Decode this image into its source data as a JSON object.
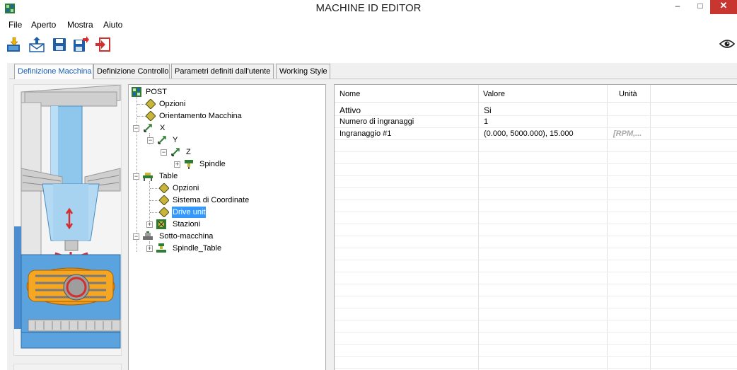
{
  "window": {
    "title": "MACHINE ID EDITOR",
    "minimize": "–",
    "maximize": "□",
    "close": "✕"
  },
  "menu": {
    "items": [
      "File",
      "Aperto",
      "Mostra",
      "Aiuto"
    ]
  },
  "toolbar": {
    "icons": [
      "import-icon",
      "export-icon",
      "save-icon",
      "save-as-icon",
      "exit-icon"
    ],
    "right_icon": "eye-icon"
  },
  "tabs": [
    {
      "label": "Definizione Macchina",
      "active": true
    },
    {
      "label": "Definizione Controllo",
      "active": false
    },
    {
      "label": "Parametri definiti dall'utente",
      "active": false
    },
    {
      "label": "Working Style",
      "active": false
    }
  ],
  "tree": {
    "nodes": [
      {
        "label": "POST",
        "icon": "machine-icon"
      },
      {
        "label": "Opzioni",
        "icon": "diamond-icon"
      },
      {
        "label": "Orientamento Macchina",
        "icon": "diamond-icon"
      },
      {
        "label": "X",
        "icon": "axis-icon",
        "expander": "−"
      },
      {
        "label": "Y",
        "icon": "axis-icon",
        "expander": "−"
      },
      {
        "label": "Z",
        "icon": "axis-icon",
        "expander": "−"
      },
      {
        "label": "Spindle",
        "icon": "spindle-icon",
        "expander": "+"
      },
      {
        "label": "Table",
        "icon": "table-icon",
        "expander": "−"
      },
      {
        "label": "Opzioni",
        "icon": "diamond-icon"
      },
      {
        "label": "Sistema di Coordinate",
        "icon": "diamond-icon"
      },
      {
        "label": "Drive unit",
        "icon": "diamond-icon",
        "selected": true
      },
      {
        "label": "Stazioni",
        "icon": "stations-icon",
        "expander": "+"
      },
      {
        "label": "Sotto-macchina",
        "icon": "submachine-icon",
        "expander": "−"
      },
      {
        "label": "Spindle_Table",
        "icon": "spindle-table-icon",
        "expander": "+"
      }
    ]
  },
  "grid": {
    "headers": [
      "Nome",
      "Valore",
      "Unità"
    ],
    "rows": [
      {
        "name": "Attivo",
        "value": "Si",
        "unit": ""
      },
      {
        "name": "Numero di ingranaggi",
        "value": "1",
        "unit": ""
      },
      {
        "name": "Ingranaggio #1",
        "value": "(0.000, 5000.000), 15.000",
        "unit": "[RPM,..."
      }
    ]
  },
  "colors": {
    "active_tab": "#1a5fb4",
    "selection": "#3399ff",
    "close_button": "#c7372f"
  }
}
